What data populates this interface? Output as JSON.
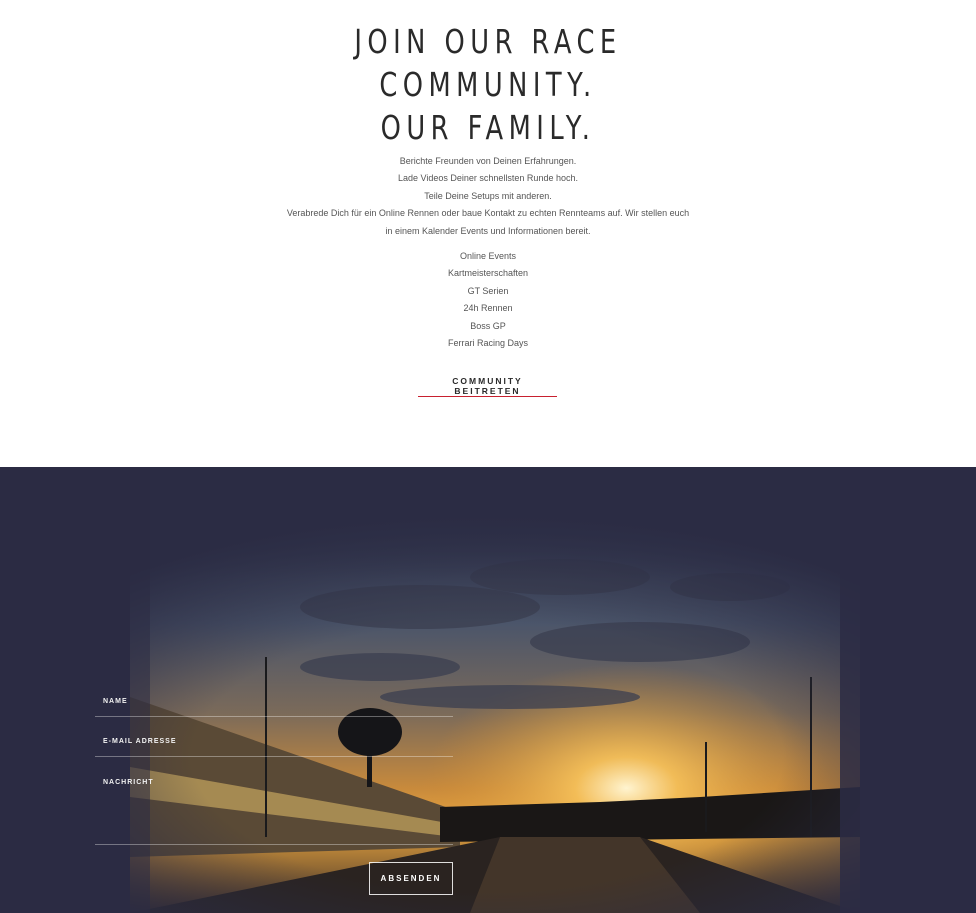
{
  "community": {
    "headline": [
      "JOIN OUR RACE",
      "COMMUNITY.",
      "OUR FAMILY."
    ],
    "intro": [
      "Berichte Freunden von Deinen Erfahrungen.",
      "Lade Videos Deiner schnellsten Runde hoch.",
      "Teile Deine Setups mit anderen.",
      "Verabrede Dich für ein Online Rennen oder baue Kontakt zu echten Rennteams auf. Wir stellen euch",
      "in einem Kalender Events und Informationen bereit."
    ],
    "events": [
      "Online Events",
      "Kartmeisterschaften",
      "GT Serien",
      "24h Rennen",
      "Boss GP",
      "Ferrari Racing Days"
    ],
    "cta_label": "COMMUNITY BEITRETEN",
    "accent_color": "#c8202f"
  },
  "contact_form": {
    "name_label": "NAME",
    "email_label": "E-MAIL ADRESSE",
    "message_label": "NACHRICHT",
    "submit_label": "ABSENDEN",
    "background_color": "#2b2c44",
    "background_image": "sunset-dragstrip-photo"
  }
}
